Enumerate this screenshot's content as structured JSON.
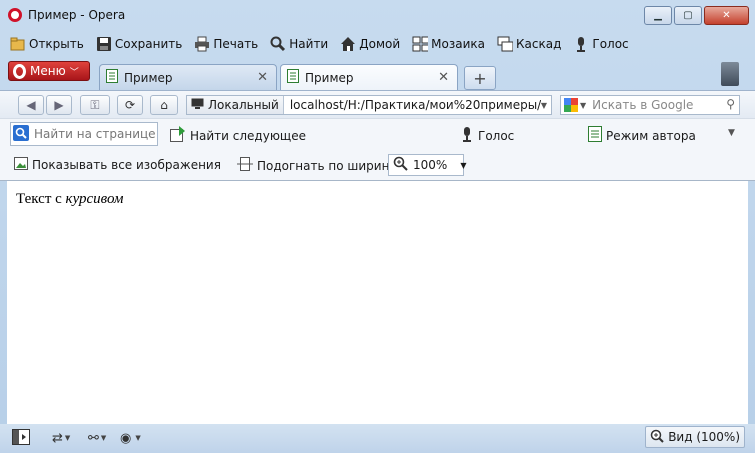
{
  "window": {
    "title": "Пример - Opera"
  },
  "window_buttons": [
    "minimize-icon",
    "maximize-icon",
    "close-icon"
  ],
  "toolbar": [
    {
      "name": "open",
      "label": "Открыть",
      "icon": "folder-icon"
    },
    {
      "name": "save",
      "label": "Сохранить",
      "icon": "floppy-icon"
    },
    {
      "name": "print",
      "label": "Печать",
      "icon": "printer-icon"
    },
    {
      "name": "find",
      "label": "Найти",
      "icon": "magnifier-icon"
    },
    {
      "name": "home",
      "label": "Домой",
      "icon": "home-icon"
    },
    {
      "name": "mosaic",
      "label": "Мозаика",
      "icon": "tiles-icon"
    },
    {
      "name": "cascade",
      "label": "Каскад",
      "icon": "cascade-icon"
    },
    {
      "name": "voice",
      "label": "Голос",
      "icon": "microphone-icon"
    }
  ],
  "menu_button": {
    "label": "Меню"
  },
  "tabs": [
    {
      "label": "Пример",
      "active": false
    },
    {
      "label": "Пример",
      "active": true
    }
  ],
  "address": {
    "badge": "Локальный",
    "url": "localhost/H:/Практика/мои%20примеры/При"
  },
  "search": {
    "placeholder": "Искать в Google"
  },
  "find_bar": {
    "placeholder": "Найти на странице",
    "find_next": "Найти следующее",
    "voice": "Голос",
    "author_mode": "Режим автора"
  },
  "image_bar": {
    "show_images": "Показывать все изображения",
    "fit_width": "Подогнать по ширине",
    "zoom": "100%"
  },
  "page": {
    "text_plain": "Текст с ",
    "text_italic": "курсивом"
  },
  "statusbar": {
    "view": "Вид (100%)"
  }
}
